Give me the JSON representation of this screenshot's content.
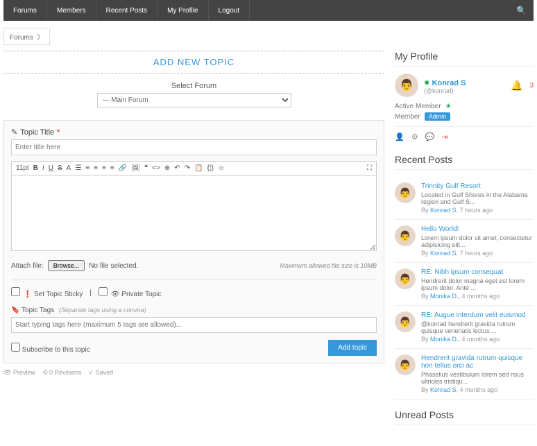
{
  "nav": {
    "forums": "Forums",
    "members": "Members",
    "recent": "Recent Posts",
    "profile": "My Profile",
    "logout": "Logout"
  },
  "breadcrumb": "Forums",
  "heading": "ADD NEW TOPIC",
  "forum_select": {
    "label": "Select Forum",
    "selected": "— Main Forum"
  },
  "form": {
    "title_label": "Topic Title",
    "title_placeholder": "Enter title here",
    "fontsize": "11pt",
    "attach_label": "Attach file:",
    "browse": "Browse...",
    "nofile": "No file selected.",
    "maxsize": "Maximum allowed file size is 10MB",
    "sticky": "Set Topic Sticky",
    "private": "Private Topic",
    "tags_label": "Topic Tags",
    "tags_help": "(Separate tags using a comma)",
    "tags_placeholder": "Start typing tags here (maximum 5 tags are allowed)...",
    "subscribe": "Subscribe to this topic",
    "submit": "Add topic",
    "preview": "Preview",
    "revisions": "0 Revisions",
    "saved": "Saved"
  },
  "profile": {
    "title": "My Profile",
    "name": "Konrad S",
    "handle": "(@konrad)",
    "notif_count": "3",
    "status": "Active Member",
    "role_label": "Member",
    "role_badge": "Admin"
  },
  "recent": {
    "title": "Recent Posts",
    "posts": [
      {
        "title": "Trinnity Gulf Resort",
        "exc": "Located in Gulf Shores in the Alabama region and Gulf S...",
        "by": "Konrad S",
        "time": "7 hours ago"
      },
      {
        "title": "Hello World!",
        "exc": "Lorem ipsum dolor sit amet, consectetur adipisicing elit...",
        "by": "Konrad S",
        "time": "7 hours ago"
      },
      {
        "title": "RE: Nibh ipsum consequat",
        "exc": "Hendrerit dolor magna eget est lorem ipsum dolor. Ante ...",
        "by": "Monika D.",
        "time": "4 months ago"
      },
      {
        "title": "RE: Augue interdum velit euismod",
        "exc": "@konrad hendrerit gravida rutrum quisque venenatis lectus ...",
        "by": "Monika D.",
        "time": "4 months ago"
      },
      {
        "title": "Hendrerit gravida rutrum quisque non tellus orci ac",
        "exc": "Phasellus vestibulum lorem sed risus ultricies tristiqu...",
        "by": "Konrad S",
        "time": "4 months ago"
      }
    ]
  },
  "unread": {
    "title": "Unread Posts"
  }
}
